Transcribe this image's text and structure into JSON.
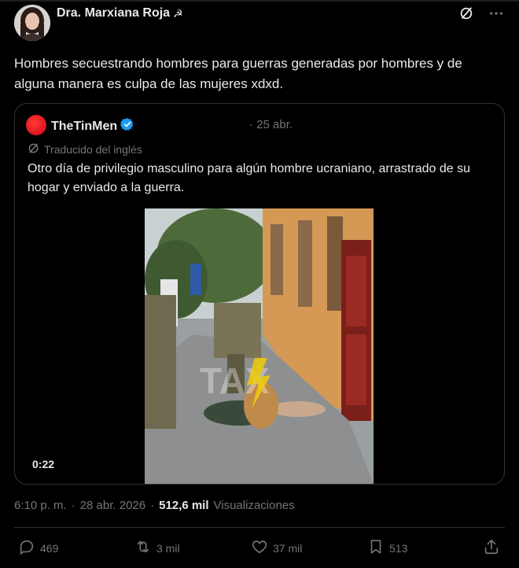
{
  "tweet": {
    "author_name": "Dra. Marxiana Roja",
    "author_emoji": "☭",
    "text": "Hombres secuestrando hombres para guerras generadas por hombres y de alguna manera es culpa de las mujeres xdxd.",
    "time": "6:10 p. m.",
    "date": "28 abr. 2026",
    "views_count": "512,6 mil",
    "views_label": "Visualizaciones"
  },
  "quote": {
    "author_name": "TheTinMen",
    "date": "· 25 abr.",
    "translated_label": "Traducido del inglés",
    "text": "Otro día de privilegio masculino para algún hombre ucraniano, arrastrado de su hogar y enviado a la guerra.",
    "media_duration": "0:22",
    "watermark": "TAX"
  },
  "actions": {
    "replies": "469",
    "reposts": "3 mil",
    "likes": "37 mil",
    "bookmarks": "513"
  },
  "colors": {
    "background": "#000000",
    "text": "#e7e9ea",
    "muted": "#71767b",
    "border": "#2f3336",
    "verified": "#1d9bf0",
    "quote_avatar": "#e0191e"
  }
}
